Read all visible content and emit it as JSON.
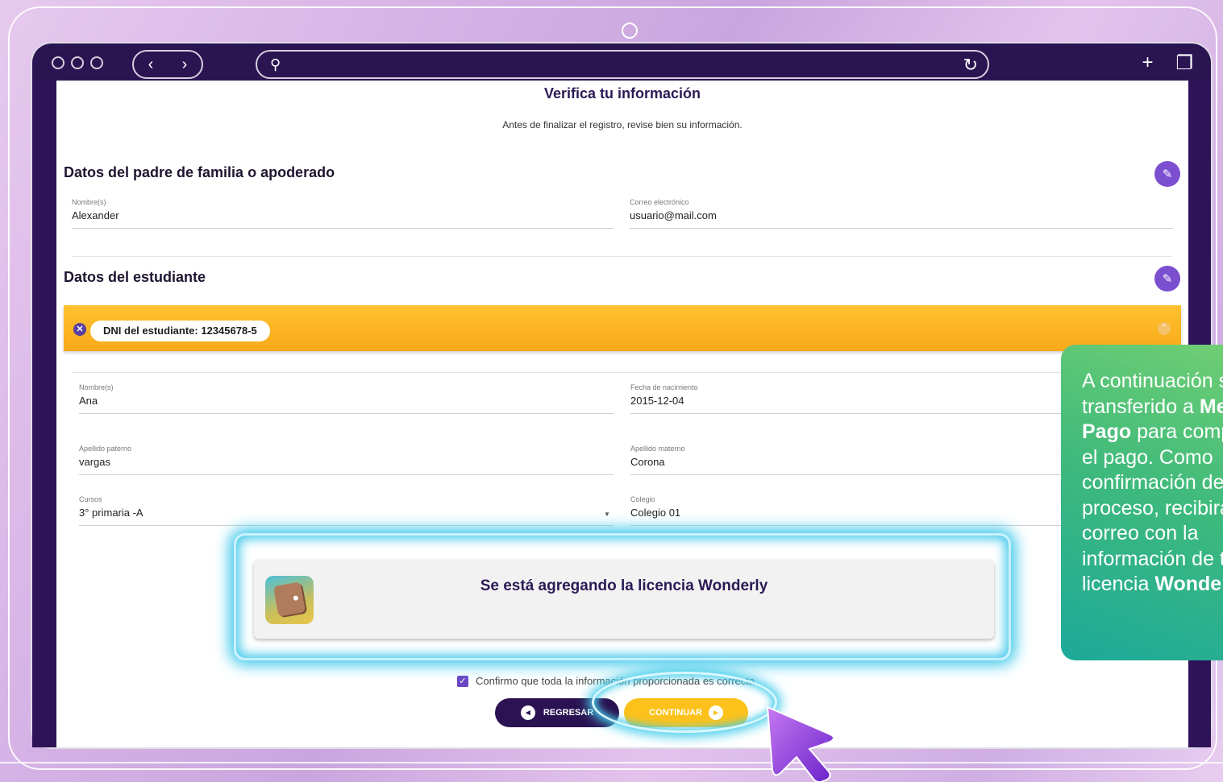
{
  "form": {
    "title": "Verifica tu información",
    "subtitle": "Antes de finalizar el registro, revise bien su información.",
    "parent_section": {
      "title": "Datos del padre de familia o apoderado",
      "name_label": "Nombre(s)",
      "name_value": "Alexander",
      "email_label": "Correo electrónico",
      "email_value": "usuario@mail.com"
    },
    "student_section": {
      "title": "Datos del estudiante",
      "dni_chip": "DNI del estudiante: 12345678-5",
      "name_label": "Nombre(s)",
      "name_value": "Ana",
      "birth_label": "Fecha de nacimiento",
      "birth_value": "2015-12-04",
      "paternal_label": "Apellido paterno",
      "paternal_value": "vargas",
      "maternal_label": "Apellido materno",
      "maternal_value": "Corona",
      "course_label": "Cursos",
      "course_value": "3° primaria -A",
      "school_label": "Colegio",
      "school_value": "Colegio 01"
    },
    "confirm_text": "Confirmo que toda la información proporcionada es correcta.",
    "back_label": "REGRESAR",
    "continue_label": "CONTINUAR"
  },
  "popup": {
    "title": "Se está agregando la licencia Wonderly",
    "icon": "wallet-icon"
  },
  "callout": {
    "text_1": "A continuación serás transferido a ",
    "bold_1": "Mercado Pago",
    "text_2": " para completar el pago. Como confirmación del proceso, recibirás un correo con la información de tu licencia ",
    "bold_2": "Wonderly"
  },
  "colors": {
    "accent_purple": "#7b4fd0",
    "dark_purple": "#2b1252",
    "yellow": "#fcc21b",
    "glow": "#3fc8ea",
    "callout_green": "#3fba7c"
  }
}
